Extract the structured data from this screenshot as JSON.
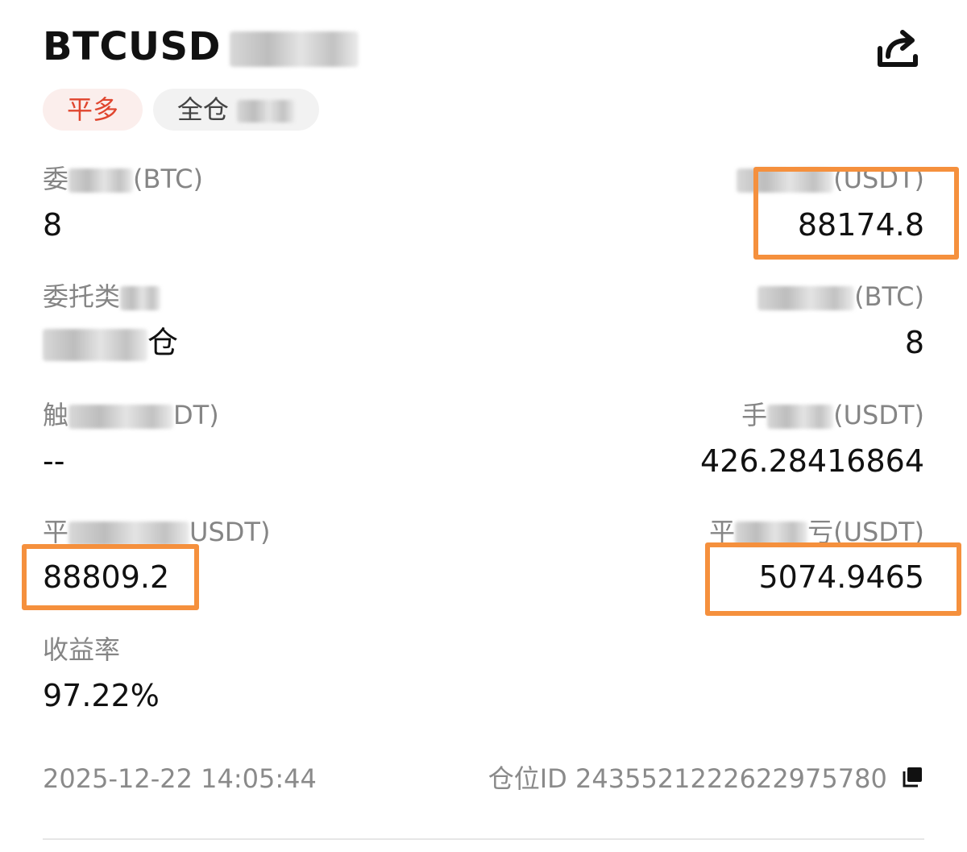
{
  "header": {
    "title": "BTCUSD",
    "share_icon": "share-icon"
  },
  "tags": {
    "side": "平多",
    "mode": "全仓"
  },
  "fields": {
    "order_qty": {
      "label_start": "委",
      "label_end": "(BTC)",
      "value": "8"
    },
    "order_price": {
      "label_end": "(USDT)",
      "value": "88174.8"
    },
    "order_type": {
      "label_start": "委托类",
      "value_end": "仓"
    },
    "filled_qty": {
      "label_end": "(BTC)",
      "value": "8"
    },
    "trigger_price": {
      "label_start": "触",
      "label_end": "DT)",
      "value": "--"
    },
    "fee": {
      "label_start": "手",
      "label_end": "(USDT)",
      "value": "426.28416864"
    },
    "close_price": {
      "label_start": "平",
      "label_end": "USDT)",
      "value": "88809.2"
    },
    "close_pnl": {
      "label_start": "平",
      "label_end": "亏(USDT)",
      "value": "5074.9465"
    },
    "roi": {
      "label": "收益率",
      "value": "97.22%"
    }
  },
  "footer": {
    "timestamp": "2025-12-22 14:05:44",
    "position_id_label": "仓位ID",
    "position_id": "2435521222622975780",
    "copy_icon": "copy-icon"
  },
  "colors": {
    "highlight": "#f5903d",
    "side_tag_text": "#e0452e",
    "side_tag_bg": "#fbeeec"
  }
}
